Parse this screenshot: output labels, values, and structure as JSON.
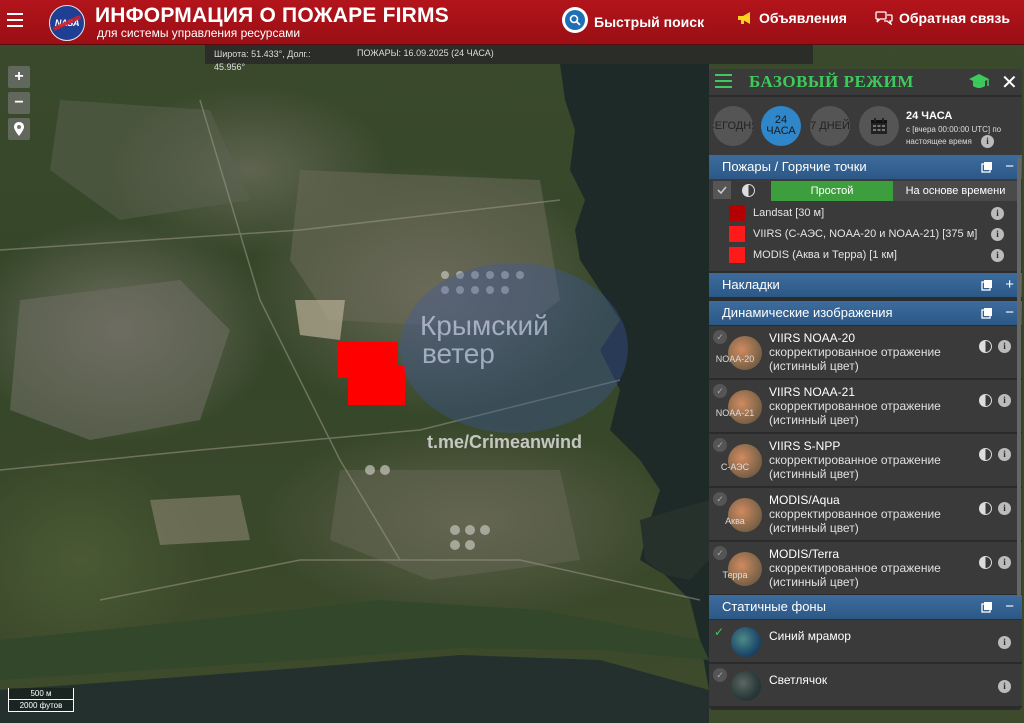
{
  "header": {
    "title": "ИНФОРМАЦИЯ О ПОЖАРЕ FIRMS",
    "subtitle": "для системы управления ресурсами",
    "logo_text": "NASA",
    "quick_search": "Быстрый поиск",
    "announcements": "Объявления",
    "feedback": "Обратная связь"
  },
  "coord_bar": {
    "lat_lon": "Широта: 51.433°, Долг.: 45.956°",
    "fires": "ПОЖАРЫ: 16.09.2025 (24 ЧАСА)"
  },
  "zoom": {
    "plus": "+",
    "minus": "−"
  },
  "watermark": {
    "line1": "Крымский",
    "line2": "ветер",
    "link": "t.me/Crimeanwind"
  },
  "scale": {
    "metric": "500 м",
    "imperial": "2000 футов"
  },
  "panel": {
    "title": "БАЗОВЫЙ РЕЖИМ",
    "time": {
      "today": "СЕГОДНЯ",
      "h24": "24 ЧАСА",
      "d7": "7 ДНЕЙ",
      "label": "24 ЧАСА",
      "desc": "с [вчера 00:00:00 UTC] по настоящее время"
    },
    "fires_section": "Пожары / Горячие точки",
    "tabs": {
      "simple": "Простой",
      "time_based": "На основе времени"
    },
    "sensors": [
      {
        "label": "Landsat [30 м]",
        "color": "#b30000"
      },
      {
        "label": "VIIRS (С-АЭС, NOAA-20 и NOAA-21) [375 м]",
        "color": "#ff1a1a"
      },
      {
        "label": "MODIS (Аква и Терра) [1 км]",
        "color": "#ff1a1a"
      }
    ],
    "overlays_section": "Накладки",
    "dynamic_section": "Динамические изображения",
    "dynamic_layers": [
      {
        "thumb": "NOAA-20",
        "name": "VIIRS NOAA-20",
        "desc": "скорректированное отражение (истинный цвет)"
      },
      {
        "thumb": "NOAA-21",
        "name": "VIIRS NOAA-21",
        "desc": "скорректированное отражение (истинный цвет)"
      },
      {
        "thumb": "С-АЭС",
        "name": "VIIRS S-NPP",
        "desc": "скорректированное отражение (истинный цвет)"
      },
      {
        "thumb": "Аква",
        "name": "MODIS/Aqua",
        "desc": "скорректированное отражение (истинный цвет)"
      },
      {
        "thumb": "Терра",
        "name": "MODIS/Terra",
        "desc": "скорректированное отражение (истинный цвет)"
      }
    ],
    "static_section": "Статичные фоны",
    "static_layers": [
      {
        "name": "Синий мрамор"
      },
      {
        "name": "Светлячок"
      }
    ]
  },
  "colors": {
    "header_red": "#b3141b",
    "panel_green": "#3ccb5a",
    "section_blue": "#2c5885",
    "fire_red": "#ff0000"
  }
}
